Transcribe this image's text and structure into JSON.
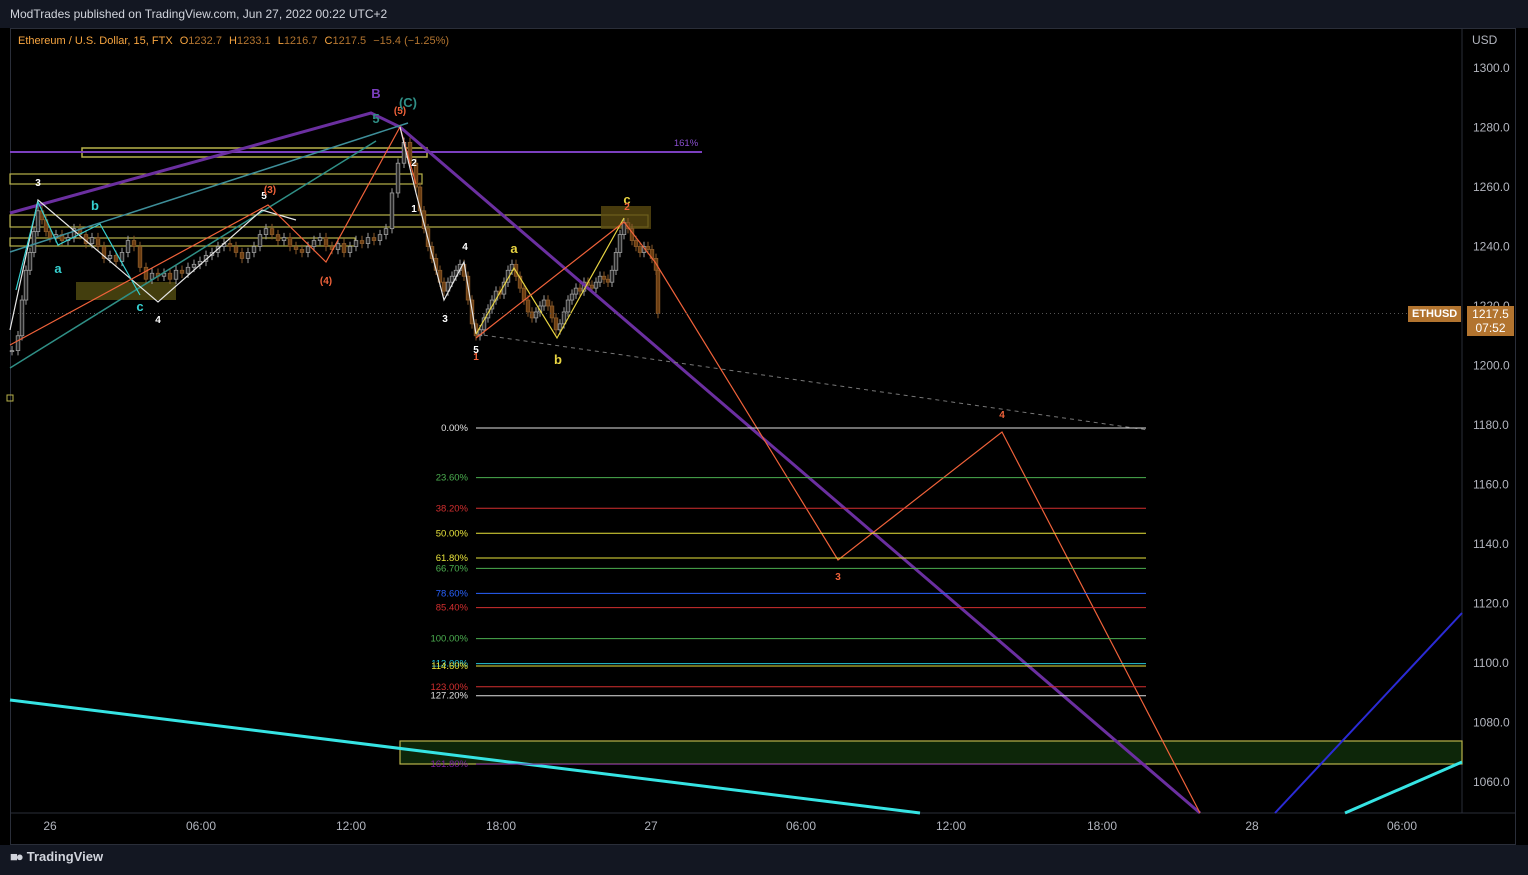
{
  "header": {
    "published_text": "ModTrades published on TradingView.com, Jun 27, 2022 00:22 UTC+2"
  },
  "legend": {
    "title": "Ethereum / U.S. Dollar, 15, FTX",
    "open_key": "O",
    "open": "1232.7",
    "high_key": "H",
    "high": "1233.1",
    "low_key": "L",
    "low": "1216.7",
    "close_key": "C",
    "close": "1217.5",
    "change": "−15.4 (−1.25%)"
  },
  "price_tag": {
    "symbol": "ETHUSD",
    "price": "1217.5",
    "countdown": "07:52"
  },
  "footer": {
    "brand": "TradingView"
  },
  "colors": {
    "background": "#000000",
    "price_tag": "#b2742f",
    "purple_channel": "#6b2fa0",
    "cyan_line": "#36e4e4",
    "orange_projection": "#f0623a",
    "zone_yellow": "#b8b24a",
    "blue_line": "#2b2bd6"
  },
  "chart_data": {
    "type": "candlestick",
    "symbol": "ETHUSD",
    "timeframe": "15",
    "ylabel": "USD",
    "y_ticks": [
      1300.0,
      1280.0,
      1260.0,
      1240.0,
      1220.0,
      1200.0,
      1180.0,
      1160.0,
      1140.0,
      1120.0,
      1100.0,
      1080.0,
      1060.0
    ],
    "y_tick_labels": [
      "1300.0",
      "1280.0",
      "1260.0",
      "1240.0",
      "1220.0",
      "1200.0",
      "1180.0",
      "1160.0",
      "1140.0",
      "1120.0",
      "1100.0",
      "1080.0",
      "1060.0"
    ],
    "ylim": [
      1050,
      1310
    ],
    "x_tick_labels": [
      "26",
      "06:00",
      "12:00",
      "18:00",
      "27",
      "06:00",
      "12:00",
      "18:00",
      "28",
      "06:00"
    ],
    "fib_levels": [
      {
        "label": "0.00%",
        "price": 1179.0,
        "color": "#e0e0e0"
      },
      {
        "label": "23.60%",
        "price": 1162.3,
        "color": "#4caf50"
      },
      {
        "label": "38.20%",
        "price": 1152.0,
        "color": "#d32f2f"
      },
      {
        "label": "50.00%",
        "price": 1143.6,
        "color": "#e8e33b"
      },
      {
        "label": "61.80%",
        "price": 1135.3,
        "color": "#e8e33b"
      },
      {
        "label": "66.70%",
        "price": 1131.8,
        "color": "#4caf50"
      },
      {
        "label": "78.60%",
        "price": 1123.4,
        "color": "#2962ff"
      },
      {
        "label": "85.40%",
        "price": 1118.6,
        "color": "#d32f2f"
      },
      {
        "label": "100.00%",
        "price": 1108.2,
        "color": "#4caf50"
      },
      {
        "label": "113.00%",
        "price": 1099.8,
        "color": "#26c6da"
      },
      {
        "label": "114.60%",
        "price": 1099.0,
        "color": "#e8e33b"
      },
      {
        "label": "123.00%",
        "price": 1092.0,
        "color": "#d32f2f"
      },
      {
        "label": "127.20%",
        "price": 1089.0,
        "color": "#e0e0e0"
      },
      {
        "label": "161.80%",
        "price": 1066.0,
        "color": "#7b1fa2"
      }
    ],
    "extension_label": "161%",
    "wave_labels_white": [
      "3",
      "4",
      "5",
      "1",
      "4",
      "3",
      "5",
      "2"
    ],
    "wave_labels_cyan": [
      "a",
      "b",
      "c"
    ],
    "wave_labels_yellow": [
      "a",
      "b",
      "c"
    ],
    "wave_labels_orange": [
      "(3)",
      "(4)",
      "(5)",
      "1",
      "2",
      "3",
      "4"
    ],
    "wave_labels_major": [
      "B",
      "(C)",
      "5"
    ]
  }
}
